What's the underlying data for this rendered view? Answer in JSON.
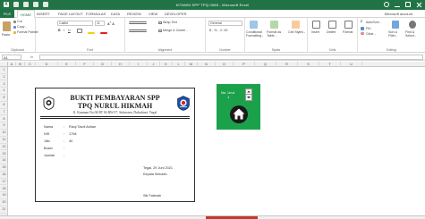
{
  "window": {
    "title": "KITANSI SPP TPQ 0085 - Microsoft Excel",
    "account": "Microsoft account"
  },
  "ribbon": {
    "tabs": [
      "FILE",
      "HOME",
      "INSERT",
      "PAGE LAYOUT",
      "FORMULAS",
      "DATA",
      "REVIEW",
      "VIEW",
      "DEVELOPER"
    ],
    "active_tab": "HOME",
    "clipboard": {
      "cut": "Cut",
      "copy": "Copy -",
      "format_painter": "Format Painter",
      "paste": "Paste",
      "label": "Clipboard"
    },
    "font": {
      "name": "Calibri",
      "size": "11",
      "label": "Font"
    },
    "alignment": {
      "wrap_text": "Wrap Text",
      "merge": "Merge & Center -",
      "label": "Alignment"
    },
    "number": {
      "format": "General",
      "label": "Number"
    },
    "styles": {
      "conditional": "Conditional Formatting -",
      "format_table": "Format as Table -",
      "cell_styles": "Cell Styles -",
      "label": "Styles"
    },
    "cells": {
      "insert": "Insert",
      "delete": "Delete",
      "format": "Format",
      "label": "Cells"
    },
    "editing": {
      "autosum": "AutoSum -",
      "fill": "Fill -",
      "clear": "Clear -",
      "sort": "Sort & Filter -",
      "find": "Find & Select -",
      "label": "Editing"
    }
  },
  "formula_bar": {
    "name_box": "A1",
    "fx": "fx",
    "formula": ""
  },
  "grid": {
    "columns": [
      "A",
      "B",
      "C",
      "D",
      "E",
      "F",
      "G",
      "H",
      "I",
      "J",
      "K",
      "L",
      "M",
      "N",
      "O",
      "P",
      "Q",
      "R",
      "S",
      "T",
      "U"
    ],
    "rows": [
      "1",
      "2",
      "3",
      "4",
      "5",
      "6",
      "7",
      "8",
      "9",
      "10",
      "11",
      "12",
      "13",
      "14",
      "15",
      "16",
      "17",
      "18",
      "19",
      "20",
      "21"
    ]
  },
  "receipt": {
    "title1": "BUKTI PEMBAYARAN SPP",
    "title2": "TPQ NURUL HIKMAH",
    "address": "Jl. Kauman No.04 RT 04 RW 07, Sidatoten, Dukuhturi, Tegal",
    "fields": [
      {
        "label": "Nama",
        "value": "Rizqi Tavdi Adrian"
      },
      {
        "label": "NIS",
        "value": "1798"
      },
      {
        "label": "Jilid",
        "value": "40"
      },
      {
        "label": "Bulan",
        "value": ""
      },
      {
        "label": "Jumlah",
        "value": ""
      }
    ],
    "date_line": "Tegal, 29 Juni 2021",
    "position": "Kepala Sekolah",
    "signer": "Siti Fatimah"
  },
  "control_panel": {
    "spin_label": "No. Urut",
    "spin_value": "1",
    "home_icon": "home-icon"
  },
  "colors": {
    "excel_green": "#217346",
    "panel_green": "#1ca14b",
    "sheet_accent": "#c0392b"
  }
}
